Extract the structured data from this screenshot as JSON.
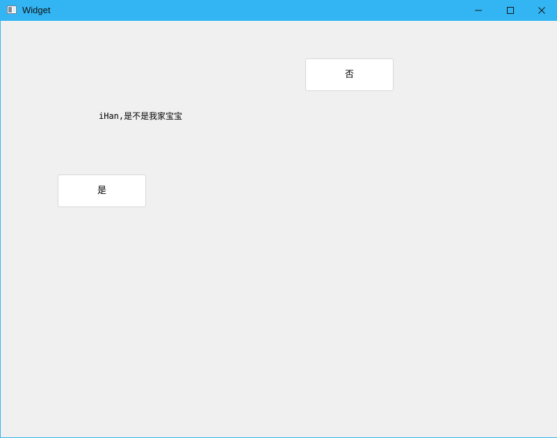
{
  "window": {
    "title": "Widget",
    "title_bar_color": "#33b5f3",
    "background_color": "#f0f0f0",
    "controls": {
      "minimize_icon": "minimize-icon",
      "maximize_icon": "maximize-icon",
      "close_icon": "close-icon"
    }
  },
  "content": {
    "question": "iHan,是不是我家宝宝",
    "buttons": {
      "no_label": "否",
      "yes_label": "是"
    }
  }
}
